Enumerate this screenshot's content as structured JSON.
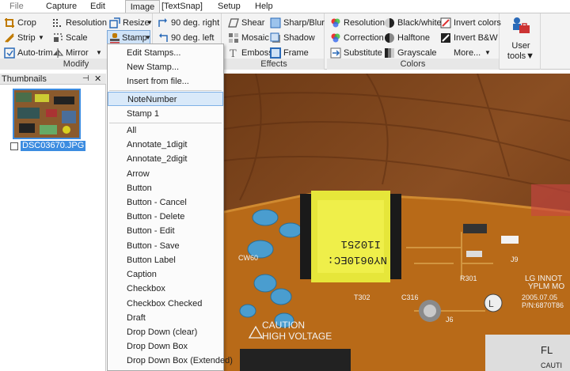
{
  "menubar": {
    "tabs": [
      "File",
      "Capture",
      "Edit",
      "Image",
      "[TextSnap]",
      "Setup",
      "Help"
    ],
    "active": "Image"
  },
  "ribbon": {
    "modify": {
      "label": "Modify",
      "crop": "Crop",
      "resolution": "Resolution",
      "resize": "Resize",
      "strip": "Strip",
      "scale": "Scale",
      "stamp": "Stamp",
      "autotrim": "Auto-trim",
      "mirror": "Mirror",
      "rot_right": "90 deg. right",
      "rot_left": "90 deg. left"
    },
    "effects": {
      "label": "Effects",
      "shear": "Shear",
      "sharp_blur": "Sharp/Blur",
      "mosaic": "Mosaic",
      "shadow": "Shadow",
      "emboss": "Emboss",
      "frame": "Frame"
    },
    "colors": {
      "label": "Colors",
      "resolution": "Resolution",
      "black_white": "Black/white",
      "invert_colors": "Invert colors",
      "correction": "Correction",
      "halftone": "Halftone",
      "invert_bw": "Invert B&W",
      "substitute": "Substitute",
      "grayscale": "Grayscale",
      "more": "More..."
    },
    "user_tools": {
      "line1": "User",
      "line2": "tools"
    }
  },
  "thumbnails": {
    "title": "Thumbnails",
    "file_name": "DSC03670.JPG"
  },
  "stamp_menu": {
    "top_items": [
      "Edit Stamps...",
      "New Stamp...",
      "Insert from file..."
    ],
    "recent": [
      "NoteNumber",
      "Stamp  1"
    ],
    "selected": "NoteNumber",
    "all_items": [
      "All",
      "Annotate_1digit",
      "Annotate_2digit",
      "Arrow",
      "Button",
      "Button - Cancel",
      "Button - Delete",
      "Button - Edit",
      "Button - Save",
      "Button Label",
      "Caption",
      "Checkbox",
      "Checkbox Checked",
      "Draft",
      "Drop Down (clear)",
      "Drop Down Box",
      "Drop Down Box (Extended)"
    ]
  },
  "photo": {
    "transformer_line1": "I10251",
    "transformer_line2": "NY0610EC:",
    "caution1": "CAUTION",
    "caution2": "HIGH VOLTAGE",
    "lg_line1": "LG INNOT",
    "lg_line2": "YPLM  MO",
    "date_code": "2005.07.05",
    "pn": "P/N:6870T86",
    "ref_cw60": "CW60",
    "ref_t302": "T302",
    "ref_c316": "C316",
    "ref_j6": "J6",
    "ref_j9": "J9",
    "ref_r301": "R301",
    "ref_fl": "FL",
    "ref_cauti": "CAUTI"
  }
}
